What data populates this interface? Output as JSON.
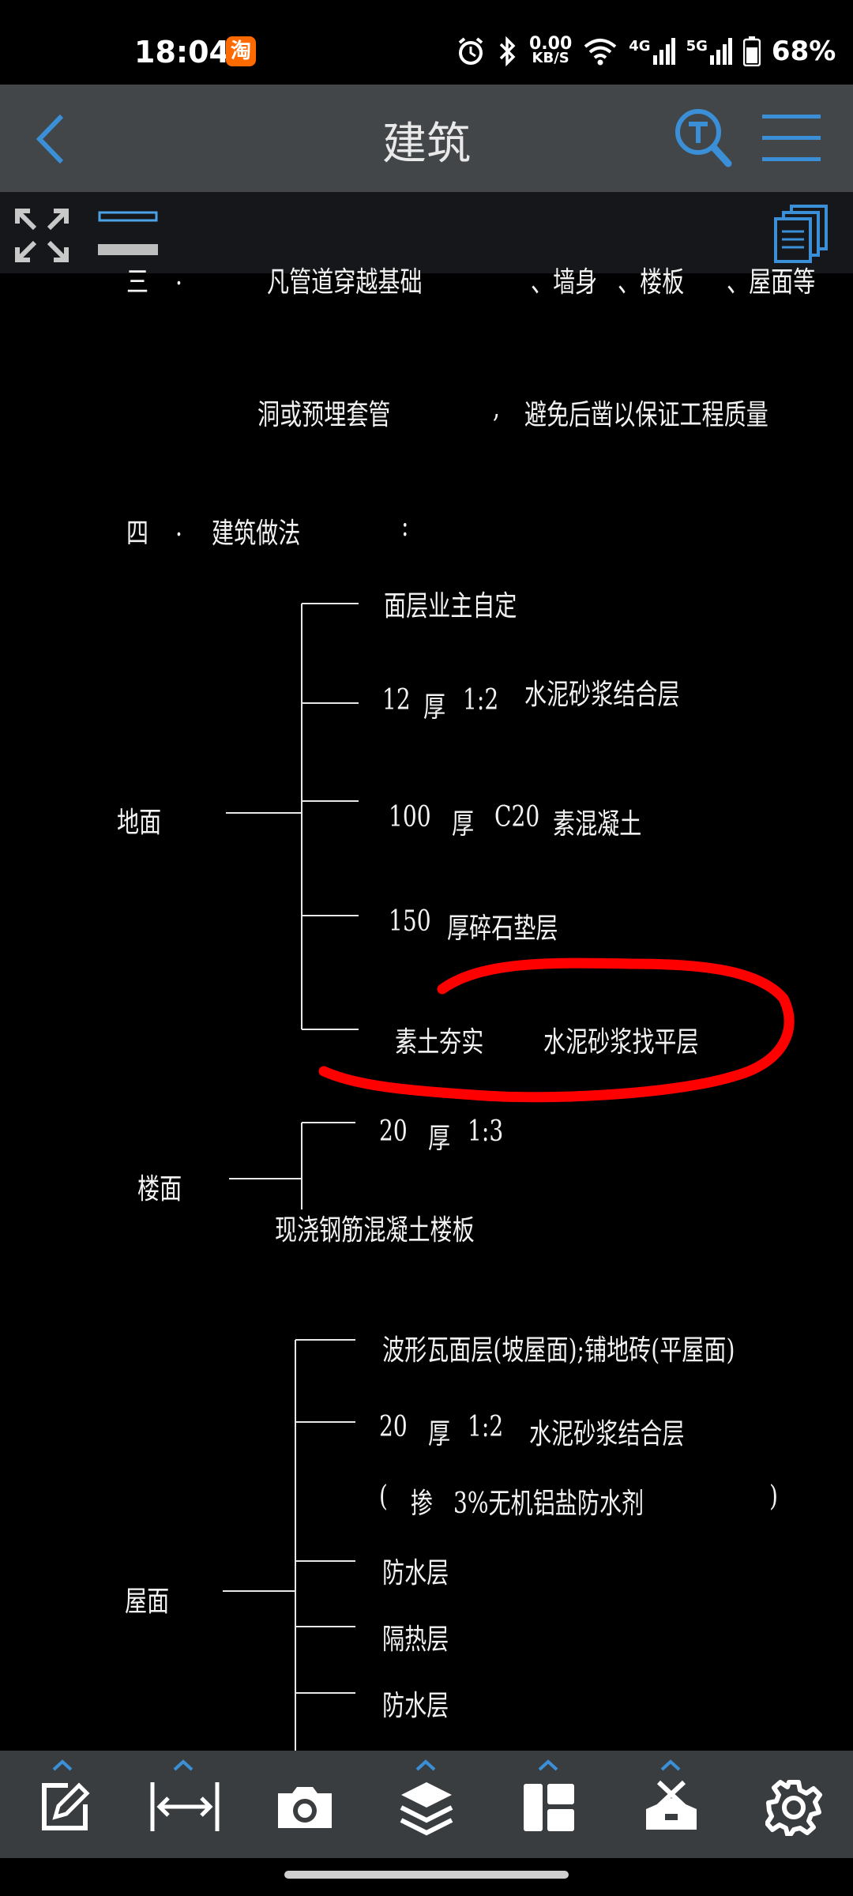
{
  "status_bar": {
    "time": "18:04",
    "speed_value": "0.00",
    "speed_unit": "KB/S",
    "net_4g": "4G",
    "net_5g": "5G",
    "battery": "68%",
    "icons": [
      "taobao-app-icon",
      "alarm-icon",
      "bluetooth-icon",
      "wifi-icon",
      "signal-4g-icon",
      "signal-5g-icon",
      "battery-icon"
    ]
  },
  "header": {
    "title": "建筑",
    "icons": [
      "back-icon",
      "text-search-icon",
      "menu-icon"
    ]
  },
  "toolstrip": {
    "icons": [
      "fullscreen-icon",
      "layer-toggle-icon",
      "pages-icon"
    ]
  },
  "drawing": {
    "line_3a": [
      "三",
      ".",
      "凡管道穿越基础",
      "、墙身",
      "、楼板",
      "、屋面等"
    ],
    "line_3b": [
      "洞或预埋套管",
      ",",
      "避免后凿以保证工程质量"
    ],
    "section_4": [
      "四",
      ".",
      "建筑做法",
      ":"
    ],
    "ground": {
      "label": "地面",
      "layers": [
        "面层业主自定",
        "12",
        "厚",
        "1:2",
        "水泥砂浆结合层",
        "100",
        "厚",
        "C20",
        "素混凝土",
        "150",
        "厚碎石垫层",
        "素土夯实",
        "水泥砂浆找平层"
      ]
    },
    "floor": {
      "label": "楼面",
      "layers": [
        "20",
        "厚",
        "1:3",
        "现浇钢筋混凝土楼板"
      ]
    },
    "roof": {
      "label": "屋面",
      "layers": [
        "波形瓦面层(坡屋面);铺地砖(平屋面)",
        "20",
        "厚",
        "1:2",
        "水泥砂浆结合层",
        "(",
        "掺",
        "3%无机铝盐防水剂",
        ")",
        "防水层",
        "隔热层",
        "防水层"
      ]
    },
    "annotation_color": "#ff0000"
  },
  "bottom_bar": {
    "icons": [
      "edit-icon",
      "measure-icon",
      "camera-icon",
      "layers-icon",
      "layout-icon",
      "tools-icon",
      "settings-icon"
    ],
    "accent": "#3a8fd6"
  }
}
